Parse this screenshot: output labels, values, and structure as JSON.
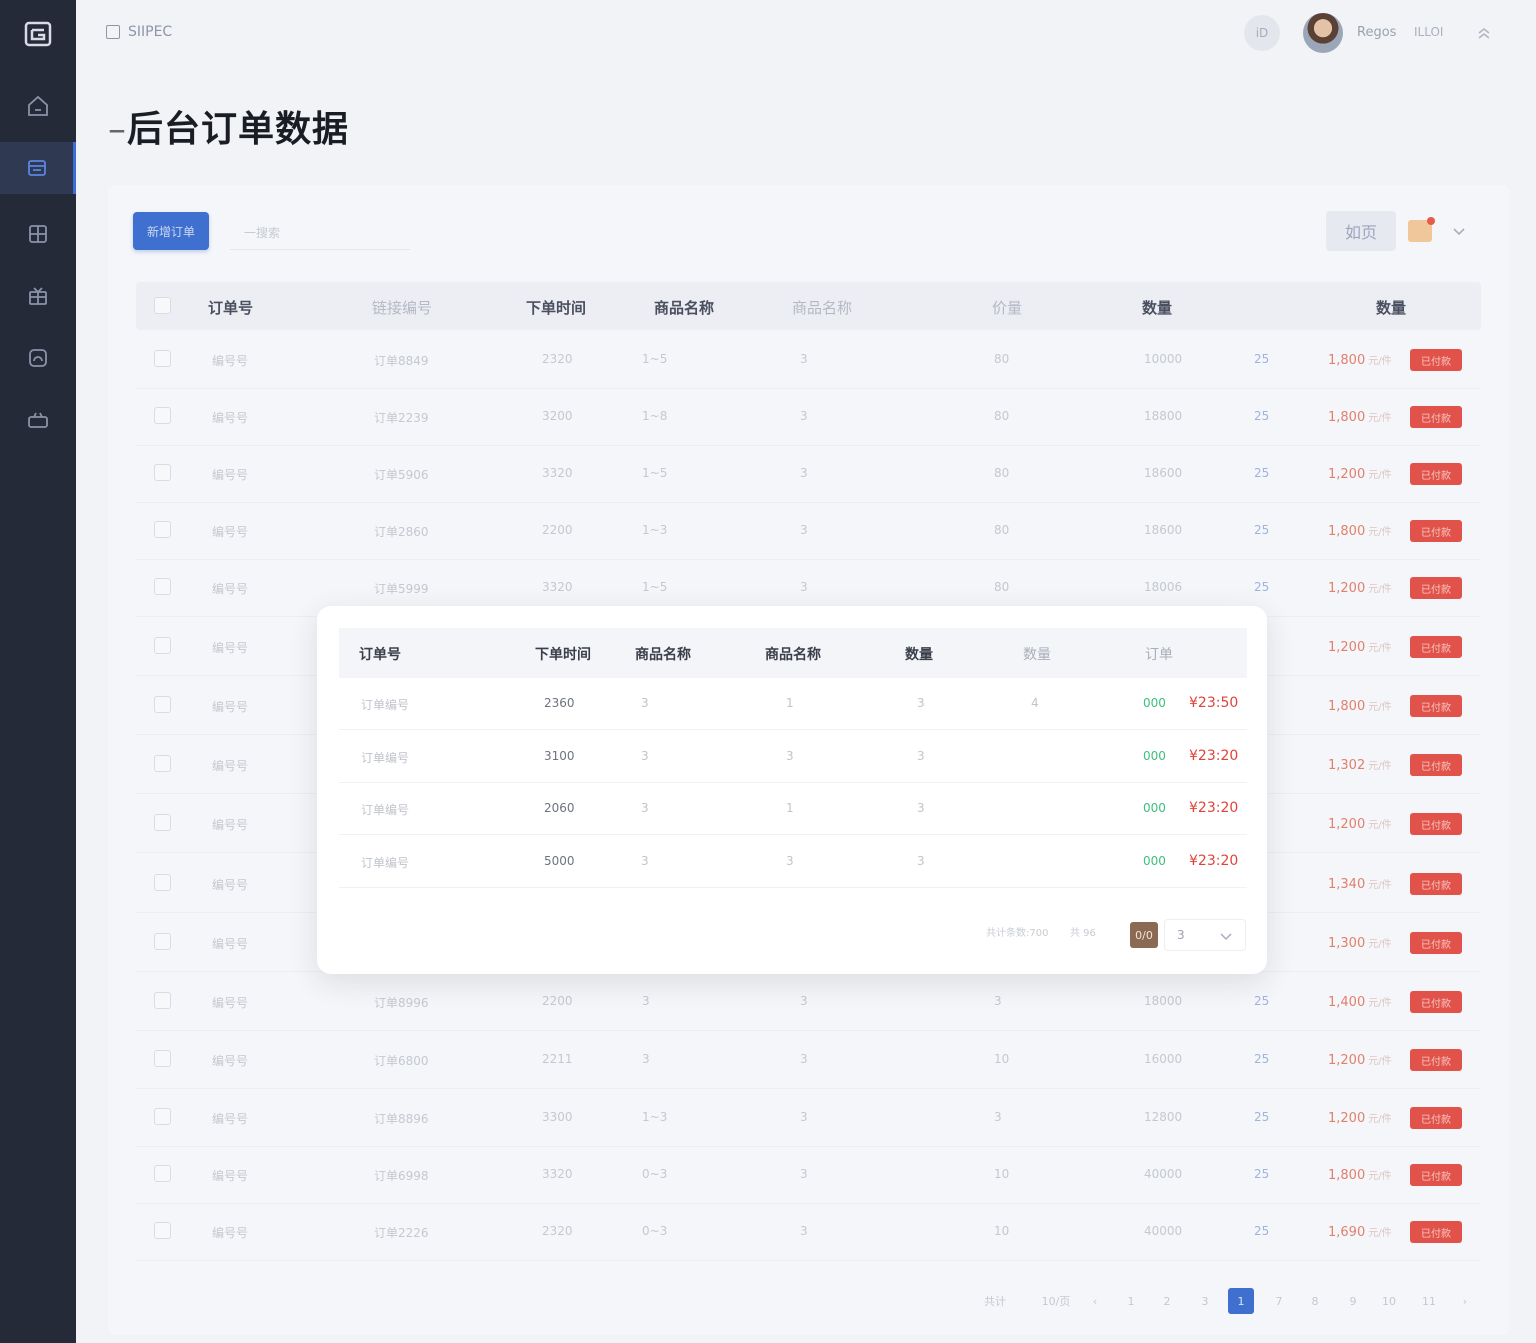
{
  "header": {
    "brand": "SIIPEC",
    "top_badge": "iD",
    "user_name": "Regos",
    "user_role": "ILLOI"
  },
  "page": {
    "title_dash": "–",
    "title": "后台订单数据"
  },
  "toolbar": {
    "primary_button": "新增订单",
    "search_placeholder": "一搜索",
    "home_button": "如页"
  },
  "table": {
    "headers": [
      "订单号",
      "链接编号",
      "下单时间",
      "商品名称",
      "商品名称",
      "价量",
      "数量",
      "数量"
    ],
    "rows": [
      {
        "id": "编号号",
        "code": "订单8849",
        "time": "2320",
        "range": "1~5",
        "qty": "3",
        "n": "80",
        "total": "10000",
        "tag_blue": "25",
        "price": "1,800",
        "unit": "元/件",
        "status": "已付款"
      },
      {
        "id": "编号号",
        "code": "订单2239",
        "time": "3200",
        "range": "1~8",
        "qty": "3",
        "n": "80",
        "total": "18800",
        "tag_blue": "25",
        "price": "1,800",
        "unit": "元/件",
        "status": "已付款"
      },
      {
        "id": "编号号",
        "code": "订单5906",
        "time": "3320",
        "range": "1~5",
        "qty": "3",
        "n": "80",
        "total": "18600",
        "tag_blue": "25",
        "price": "1,200",
        "unit": "元/件",
        "status": "已付款"
      },
      {
        "id": "编号号",
        "code": "订单2860",
        "time": "2200",
        "range": "1~3",
        "qty": "3",
        "n": "80",
        "total": "18600",
        "tag_blue": "25",
        "price": "1,800",
        "unit": "元/件",
        "status": "已付款"
      },
      {
        "id": "编号号",
        "code": "订单5999",
        "time": "3320",
        "range": "1~5",
        "qty": "3",
        "n": "80",
        "total": "18006",
        "tag_blue": "25",
        "price": "1,200",
        "unit": "元/件",
        "status": "已付款"
      },
      {
        "id": "编号号",
        "code": "",
        "time": "",
        "range": "",
        "qty": "",
        "n": "",
        "total": "",
        "tag_blue": "",
        "price": "1,200",
        "unit": "元/件",
        "status": "已付款"
      },
      {
        "id": "编号号",
        "code": "",
        "time": "",
        "range": "",
        "qty": "",
        "n": "",
        "total": "",
        "tag_blue": "",
        "price": "1,800",
        "unit": "元/件",
        "status": "已付款"
      },
      {
        "id": "编号号",
        "code": "",
        "time": "",
        "range": "",
        "qty": "",
        "n": "",
        "total": "",
        "tag_blue": "",
        "price": "1,302",
        "unit": "元/件",
        "status": "已付款"
      },
      {
        "id": "编号号",
        "code": "",
        "time": "",
        "range": "",
        "qty": "",
        "n": "",
        "total": "",
        "tag_blue": "",
        "price": "1,200",
        "unit": "元/件",
        "status": "已付款"
      },
      {
        "id": "编号号",
        "code": "",
        "time": "",
        "range": "",
        "qty": "",
        "n": "",
        "total": "",
        "tag_blue": "",
        "price": "1,340",
        "unit": "元/件",
        "status": "已付款"
      },
      {
        "id": "编号号",
        "code": "",
        "time": "",
        "range": "",
        "qty": "",
        "n": "",
        "total": "",
        "tag_blue": "",
        "price": "1,300",
        "unit": "元/件",
        "status": "已付款"
      },
      {
        "id": "编号号",
        "code": "订单8996",
        "time": "2200",
        "range": "3",
        "qty": "3",
        "n": "3",
        "total": "18000",
        "tag_blue": "25",
        "price": "1,400",
        "unit": "元/件",
        "status": "已付款"
      },
      {
        "id": "编号号",
        "code": "订单6800",
        "time": "2211",
        "range": "3",
        "qty": "3",
        "n": "10",
        "total": "16000",
        "tag_blue": "25",
        "price": "1,200",
        "unit": "元/件",
        "status": "已付款"
      },
      {
        "id": "编号号",
        "code": "订单8896",
        "time": "3300",
        "range": "1~3",
        "qty": "3",
        "n": "3",
        "total": "12800",
        "tag_blue": "25",
        "price": "1,200",
        "unit": "元/件",
        "status": "已付款"
      },
      {
        "id": "编号号",
        "code": "订单6998",
        "time": "3320",
        "range": "0~3",
        "qty": "3",
        "n": "10",
        "total": "40000",
        "tag_blue": "25",
        "price": "1,800",
        "unit": "元/件",
        "status": "已付款"
      },
      {
        "id": "编号号",
        "code": "订单2226",
        "time": "2320",
        "range": "0~3",
        "qty": "3",
        "n": "10",
        "total": "40000",
        "tag_blue": "25",
        "price": "1,690",
        "unit": "元/件",
        "status": "已付款"
      }
    ]
  },
  "pagination": {
    "total_label": "共计",
    "size_label": "10/页",
    "items": [
      "‹",
      "1",
      "2",
      "3",
      "1",
      "7",
      "8",
      "9",
      "10",
      "11",
      "›"
    ],
    "active_index": 4
  },
  "modal": {
    "headers": [
      "订单号",
      "下单时间",
      "商品名称",
      "商品名称",
      "数量",
      "数量",
      "订单"
    ],
    "rows": [
      {
        "id": "订单编号",
        "time": "2360",
        "a": "3",
        "b": "1",
        "c": "3",
        "d": "4",
        "status": "000",
        "amount": "¥23:50"
      },
      {
        "id": "订单编号",
        "time": "3100",
        "a": "3",
        "b": "3",
        "c": "3",
        "d": "",
        "status": "000",
        "amount": "¥23:20"
      },
      {
        "id": "订单编号",
        "time": "2060",
        "a": "3",
        "b": "1",
        "c": "3",
        "d": "",
        "status": "000",
        "amount": "¥23:20"
      },
      {
        "id": "订单编号",
        "time": "5000",
        "a": "3",
        "b": "3",
        "c": "3",
        "d": "",
        "status": "000",
        "amount": "¥23:20"
      }
    ],
    "footer_total": "共计条数:700",
    "footer_page": "共 96",
    "page_box": "0/0",
    "page_select": "3"
  },
  "colors": {
    "sidebar": "#242a38",
    "primary": "#3f6fcf",
    "danger": "#e1534a",
    "success": "#3fbf7d"
  },
  "icons": [
    "logo-icon",
    "home-icon",
    "orders-icon",
    "grid-icon",
    "gift-icon",
    "dashboard-icon",
    "device-icon"
  ]
}
